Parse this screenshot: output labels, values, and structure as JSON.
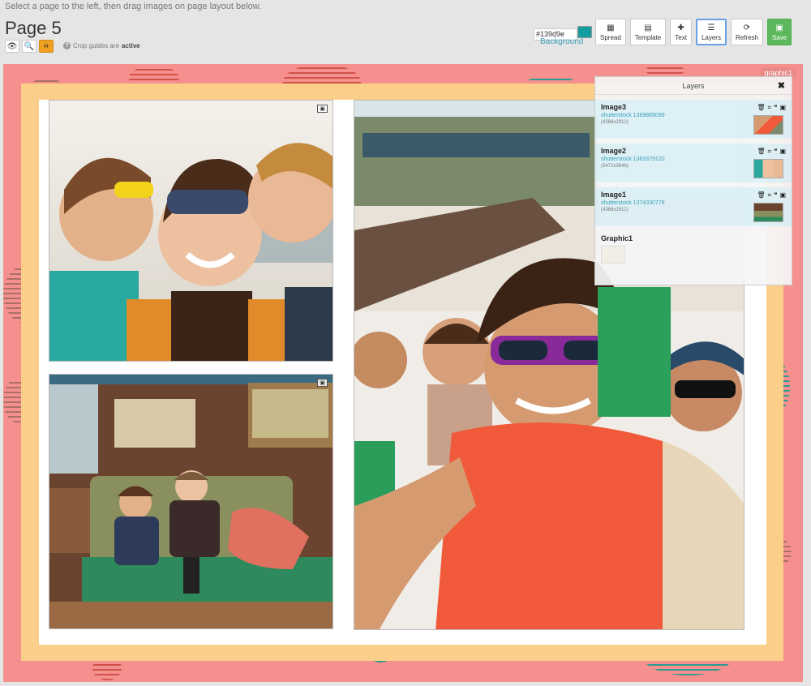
{
  "header": {
    "instruction": "Select a page to the left, then drag images on page layout below.",
    "title": "Page 5",
    "crop_note_prefix": "Crop guides are",
    "crop_note_state": "active",
    "view_tools": [
      {
        "name": "eye-icon",
        "glyph": "👁"
      },
      {
        "name": "zoom-icon",
        "glyph": "🔍"
      },
      {
        "name": "crop-icon",
        "glyph": "⌗"
      }
    ]
  },
  "background": {
    "value": "#139d9e",
    "label": "Background",
    "swatch_color": "#139d9e"
  },
  "toolbar": [
    {
      "id": "spread",
      "label": "Spread",
      "icon": "▦"
    },
    {
      "id": "template",
      "label": "Template",
      "icon": "▤"
    },
    {
      "id": "text",
      "label": "Text",
      "icon": "✚"
    },
    {
      "id": "layers",
      "label": "Layers",
      "icon": "☰"
    },
    {
      "id": "refresh",
      "label": "Refresh",
      "icon": "⟳"
    },
    {
      "id": "save",
      "label": "Save",
      "icon": "💾"
    }
  ],
  "canvas": {
    "colors": {
      "outer": "#f5908e",
      "band": "#fbcf8a",
      "inner": "#ffffff"
    },
    "graphic_tag": "graphic1",
    "photos": [
      {
        "id": "image2",
        "name": "family-kiss-photo"
      },
      {
        "id": "image1",
        "name": "kids-on-swing-photo"
      },
      {
        "id": "image3",
        "name": "family-selfie-photo"
      }
    ]
  },
  "layers_panel": {
    "title": "Layers",
    "close": "✖",
    "items": [
      {
        "name": "Image3",
        "link": "shutterstock 1369865099",
        "dims": "(4368x2912)"
      },
      {
        "name": "Image2",
        "link": "shutterstock 1363379120",
        "dims": "(5472x3648)"
      },
      {
        "name": "Image1",
        "link": "shutterstock 1374330776",
        "dims": "(4368x2912)"
      }
    ],
    "graphic": {
      "name": "Graphic1"
    }
  }
}
